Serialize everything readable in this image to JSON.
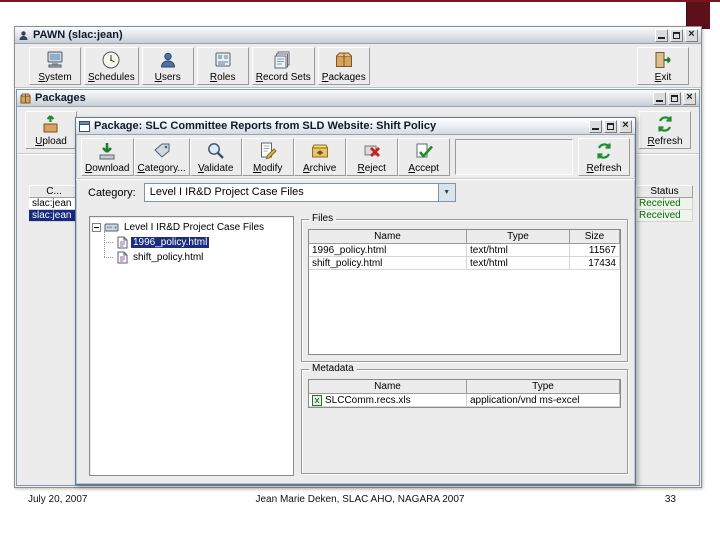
{
  "slide": {
    "footer_left": "July 20, 2007",
    "footer_center": "Jean Marie Deken, SLAC AHO, NAGARA 2007",
    "footer_right": "33"
  },
  "main_window": {
    "title": "PAWN (slac:jean)",
    "toolbar": {
      "items": [
        {
          "label": "System"
        },
        {
          "label": "Schedules"
        },
        {
          "label": "Users"
        },
        {
          "label": "Roles"
        },
        {
          "label": "Record Sets"
        },
        {
          "label": "Packages"
        }
      ],
      "exit": "Exit"
    }
  },
  "packages_window": {
    "title": "Packages",
    "toolbar": {
      "upload": "Upload",
      "refresh": "Refresh"
    },
    "table": {
      "headers": {
        "left": "C...",
        "middle": "",
        "status": "Status"
      },
      "rows": [
        {
          "creator": "slac:jean",
          "status": "Received"
        },
        {
          "creator": "slac:jean",
          "status": "Received"
        }
      ]
    }
  },
  "dialog": {
    "title": "Package: SLC Committee Reports from SLD Website: Shift Policy",
    "toolbar": {
      "items": [
        {
          "label": "Download"
        },
        {
          "label": "Category..."
        },
        {
          "label": "Validate"
        },
        {
          "label": "Modify"
        },
        {
          "label": "Archive"
        },
        {
          "label": "Reject"
        },
        {
          "label": "Accept"
        }
      ],
      "refresh": "Refresh"
    },
    "category": {
      "label": "Category:",
      "value": "Level I IR&D Project Case Files"
    },
    "tree": {
      "root": "Level I IR&D Project Case Files",
      "children": [
        {
          "label": "1996_policy.html"
        },
        {
          "label": "shift_policy.html"
        }
      ]
    },
    "files": {
      "title": "Files",
      "columns": [
        "Name",
        "Type",
        "Size"
      ],
      "rows": [
        {
          "name": "1996_policy.html",
          "type": "text/html",
          "size": "11567"
        },
        {
          "name": "shift_policy.html",
          "type": "text/html",
          "size": "17434"
        }
      ]
    },
    "metadata": {
      "title": "Metadata",
      "columns": [
        "Name",
        "Type"
      ],
      "rows": [
        {
          "name": "SLCComm.recs.xls",
          "type": "application/vnd ms-excel"
        }
      ]
    }
  }
}
